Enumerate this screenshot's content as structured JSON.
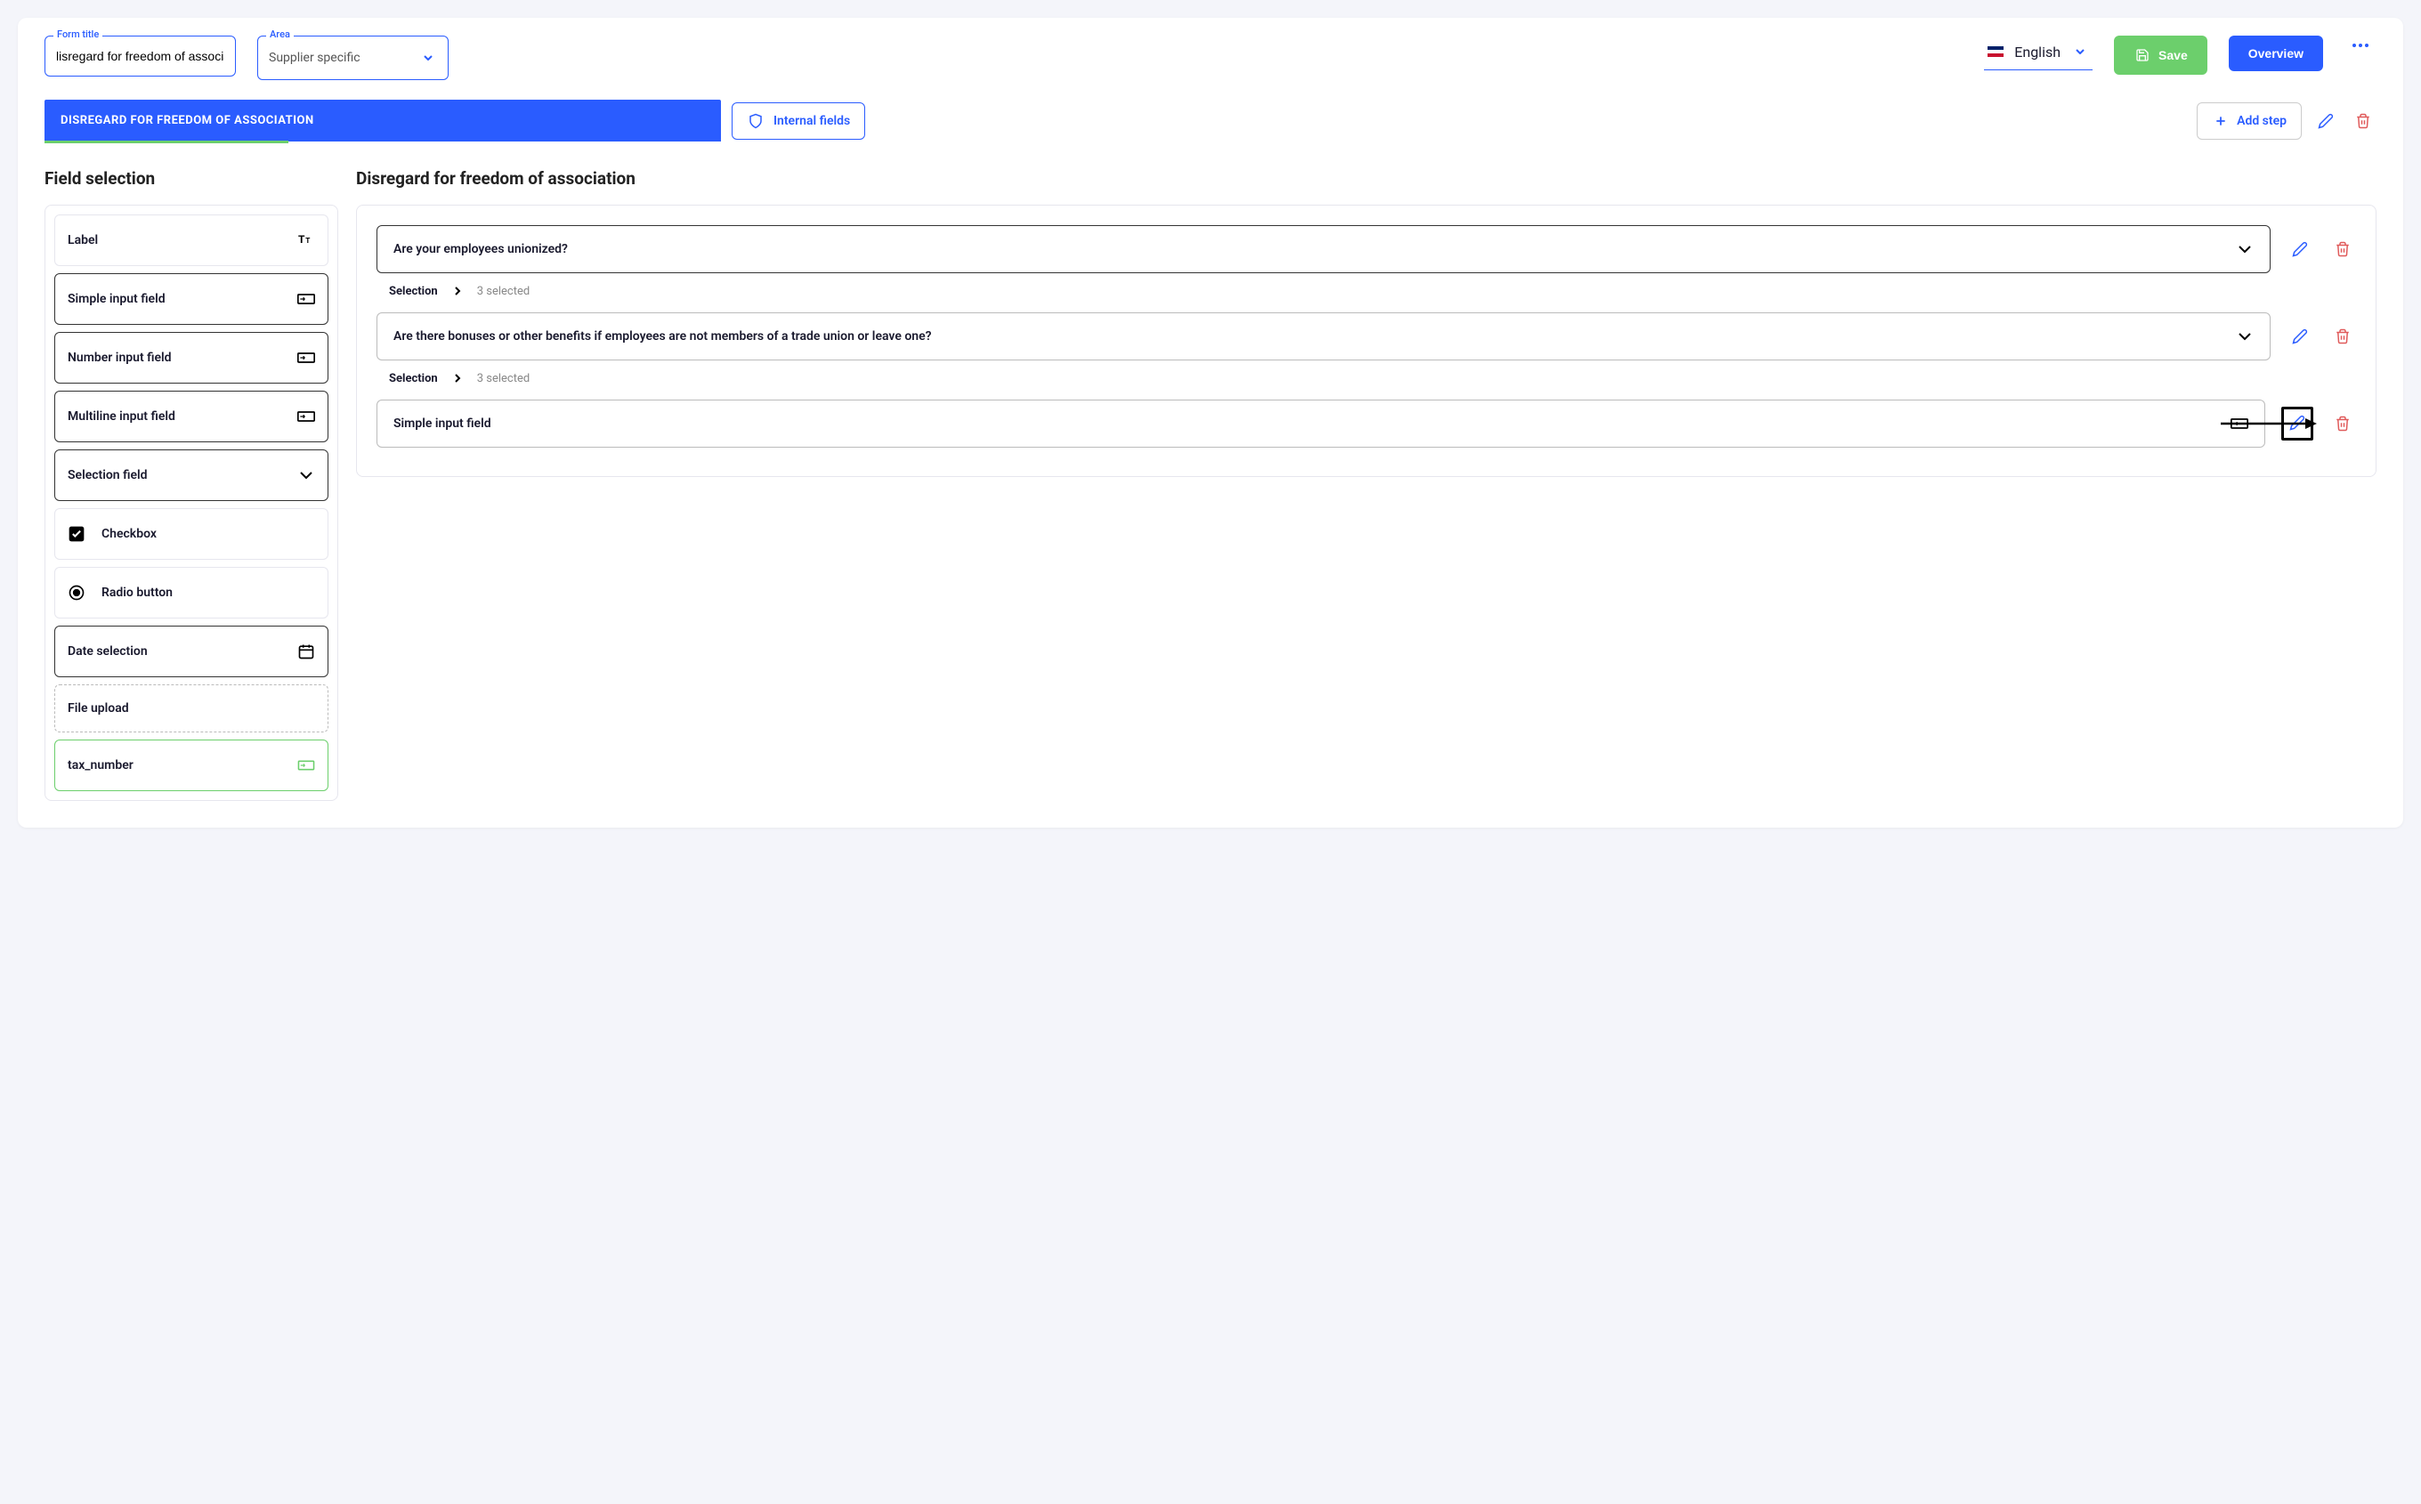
{
  "header": {
    "form_title_label": "Form title",
    "form_title_value": "lisregard for freedom of association",
    "area_label": "Area",
    "area_value": "Supplier specific",
    "language": "English",
    "save_label": "Save",
    "overview_label": "Overview"
  },
  "step": {
    "active_tab": "DISREGARD FOR FREEDOM OF ASSOCIATION",
    "internal_fields": "Internal fields",
    "add_step": "Add step"
  },
  "sidebar": {
    "title": "Field selection",
    "items": [
      {
        "label": "Label"
      },
      {
        "label": "Simple input field"
      },
      {
        "label": "Number input field"
      },
      {
        "label": "Multiline input field"
      },
      {
        "label": "Selection field"
      },
      {
        "label": "Checkbox"
      },
      {
        "label": "Radio button"
      },
      {
        "label": "Date selection"
      },
      {
        "label": "File upload"
      },
      {
        "label": "tax_number"
      }
    ]
  },
  "content": {
    "title": "Disregard for freedom of association",
    "selection_label": "Selection",
    "fields": [
      {
        "question": "Are your employees unionized?",
        "selected_text": "3 selected"
      },
      {
        "question": "Are there bonuses or other benefits if employees are not members of a trade union or leave one?",
        "selected_text": "3 selected"
      },
      {
        "question": "Simple input field"
      }
    ]
  }
}
